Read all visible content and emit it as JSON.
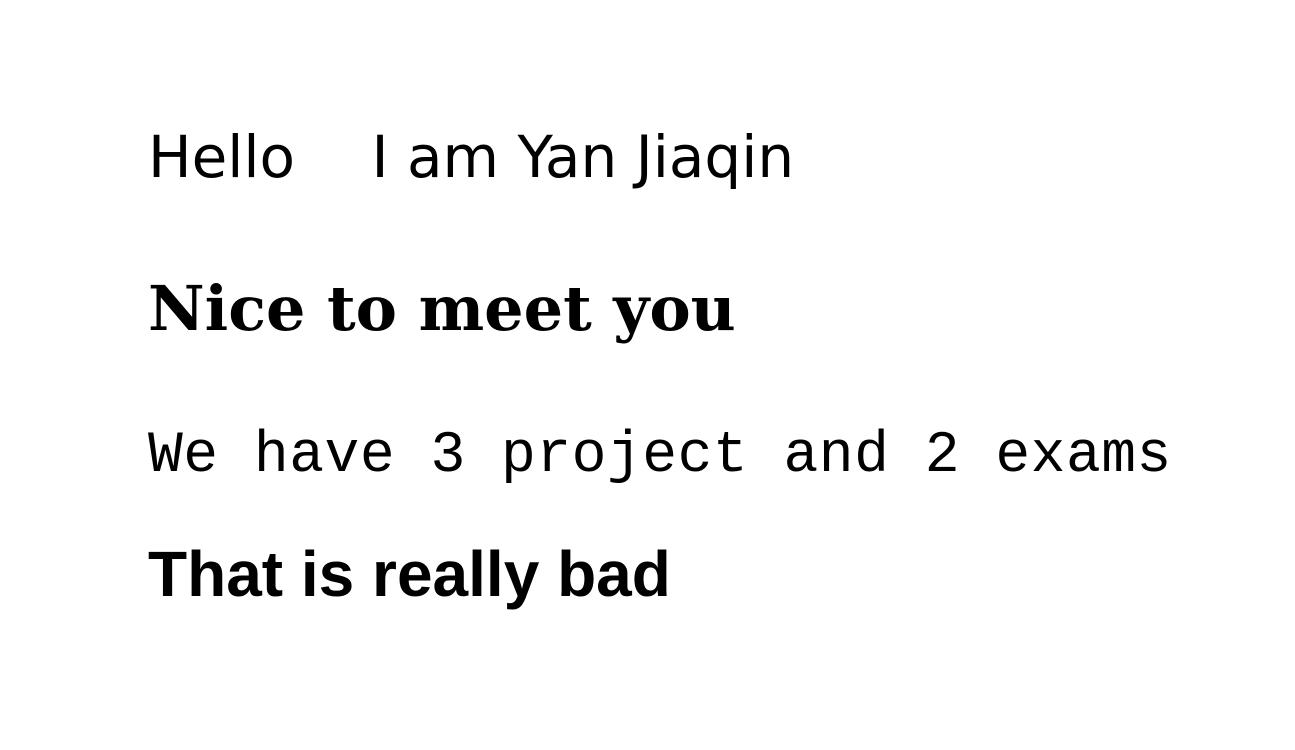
{
  "document": {
    "lines": [
      "Hello　 I am Yan Jiaqin",
      "Nice to meet you",
      "We have 3 project and 2 exams",
      "That is really bad"
    ]
  }
}
